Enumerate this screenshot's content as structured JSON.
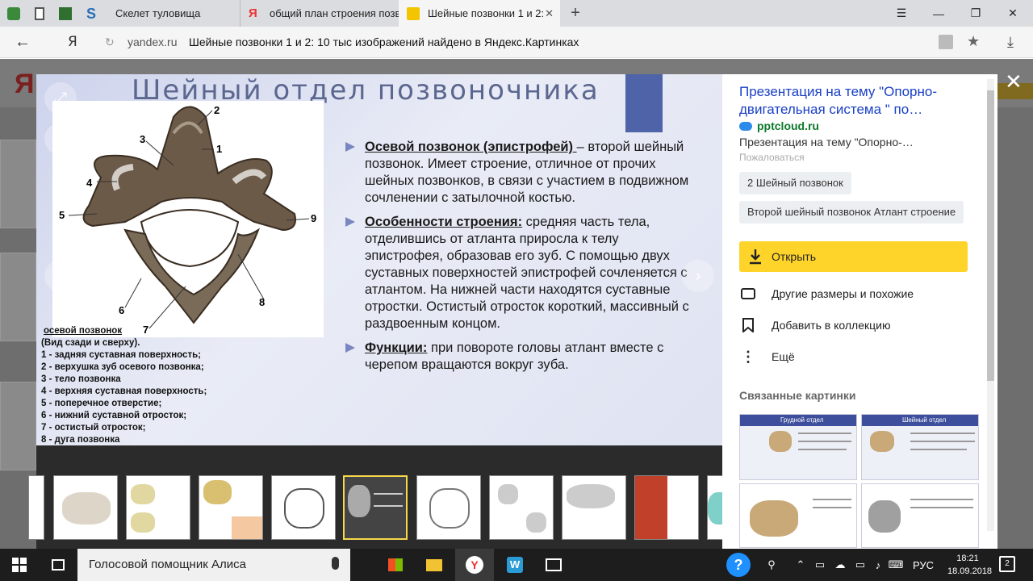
{
  "browser": {
    "tabs": [
      {
        "label": "Скелет туловища"
      },
      {
        "label": "общий план строения позв"
      },
      {
        "label": "Шейные позвонки 1 и 2:"
      }
    ],
    "address": {
      "domain": "yandex.ru",
      "page_title": "Шейные позвонки 1 и 2: 10 тыс изображений найдено в Яндекс.Картинках",
      "ya_logo": "Я"
    }
  },
  "background_page": {
    "logo": "Ян"
  },
  "slide": {
    "title": "Шейный отдел позвоночника",
    "caption": [
      "осевой позвонок",
      "(Вид сзади и сверху).",
      "1 - задняя суставная поверхность;",
      "2 - верхушка зуб осевого позвонка;",
      "3 - тело позвонка",
      "4 - верхняя суставная поверхность;",
      "5 - поперечное  отверстие;",
      "6 - нижний суставной отросток;",
      "7 - остистый  отросток;",
      "8 - дуга позвонка"
    ],
    "figure_numbers": [
      "2",
      "3",
      "1",
      "4",
      "5",
      "9",
      "6",
      "7",
      "8"
    ],
    "bullets": [
      {
        "lead": "Осевой позвонок (эпистрофей) ",
        "text": "– второй шейный позвонок. Имеет строение, отличное от прочих шейных позвонков, в связи с участием в подвижном сочленении с затылочной костью."
      },
      {
        "lead": "Особенности строения:",
        "text": " средняя часть тела, отделившись от атланта приросла к телу эпистрофея, образовав его зуб. С помощью двух суставных поверхностей эпистрофей сочленяется с атлантом. На нижней части находятся суставные отростки. Остистый отросток короткий, массивный с раздвоенным концом."
      },
      {
        "lead": "Функции:",
        "text": " при повороте головы атлант вместе с черепом вращаются вокруг зуба."
      }
    ]
  },
  "panel": {
    "title": "Презентация на тему \"Опорно-двигательная система \" по…",
    "site": "pptcloud.ru",
    "description": "Презентация на тему \"Опорно-…",
    "report": "Пожаловаться",
    "chips": [
      "2 Шейный позвонок",
      "Второй шейный позвонок Атлант строение"
    ],
    "open_label": "Открыть",
    "actions": [
      "Другие размеры и похожие",
      "Добавить в коллекцию",
      "Ещё"
    ],
    "related_title": "Связанные картинки",
    "related_headers": [
      "Грудной отдел",
      "Шейный отдел",
      "",
      ""
    ]
  },
  "taskbar": {
    "search_label": "Голосовой помощник Алиса",
    "lang": "РУС",
    "time": "18:21",
    "date": "18.09.2018",
    "notif_count": "2"
  },
  "colors": {
    "accent_yellow": "#fed42b",
    "link_blue": "#1a40c6",
    "site_green": "#0b7a2a",
    "slide_title": "#5c6790"
  }
}
